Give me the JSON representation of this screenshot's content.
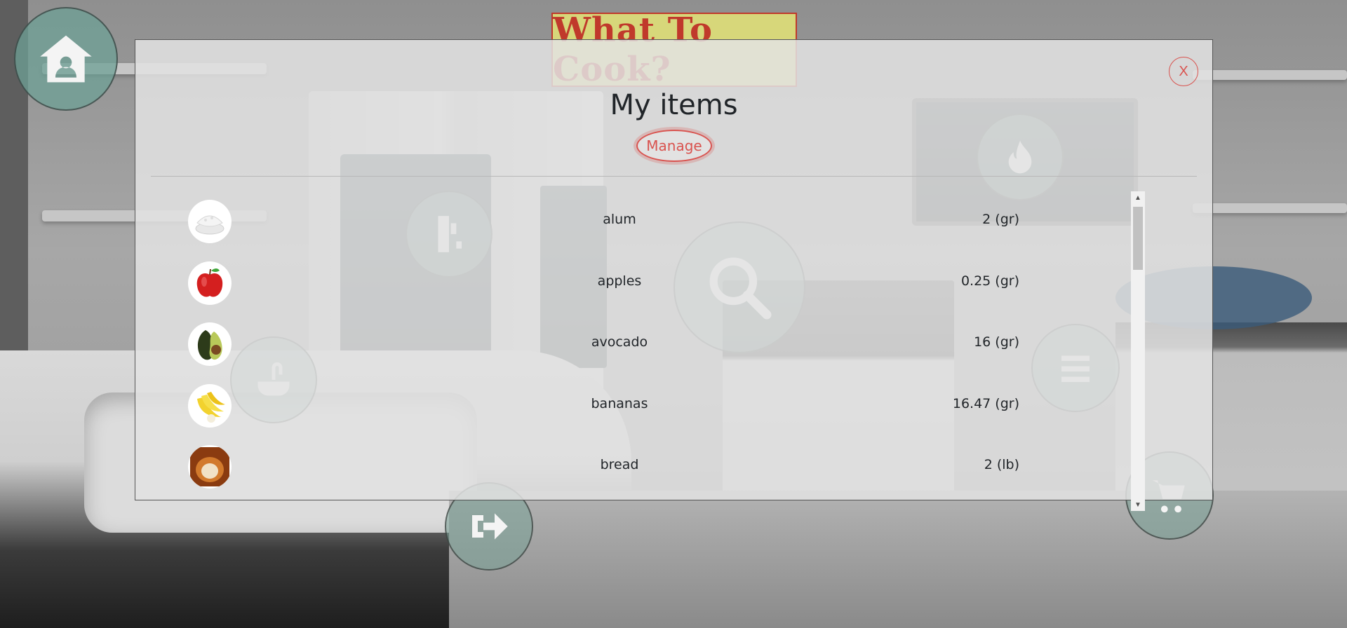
{
  "app": {
    "logo_text": "What To Cook?"
  },
  "nav": {
    "home": "home-icon",
    "fridge": "fridge-icon",
    "search": "search-icon",
    "fire": "fire-icon",
    "sink": "sink-icon",
    "list": "list-icon",
    "logout": "logout-icon",
    "cart": "cart-icon"
  },
  "modal": {
    "title": "My items",
    "manage_label": "Manage",
    "close_label": "X"
  },
  "items": [
    {
      "name": "alum",
      "quantity": "2 (gr)",
      "icon": "alum-powder-icon"
    },
    {
      "name": "apples",
      "quantity": "0.25 (gr)",
      "icon": "apple-icon"
    },
    {
      "name": "avocado",
      "quantity": "16 (gr)",
      "icon": "avocado-icon"
    },
    {
      "name": "bananas",
      "quantity": "16.47 (gr)",
      "icon": "bananas-icon"
    },
    {
      "name": "bread",
      "quantity": "2 (lb)",
      "icon": "bread-icon"
    }
  ],
  "colors": {
    "accent": "#d9534f",
    "modal_bg": "#e2e2e2",
    "text": "#212529"
  }
}
